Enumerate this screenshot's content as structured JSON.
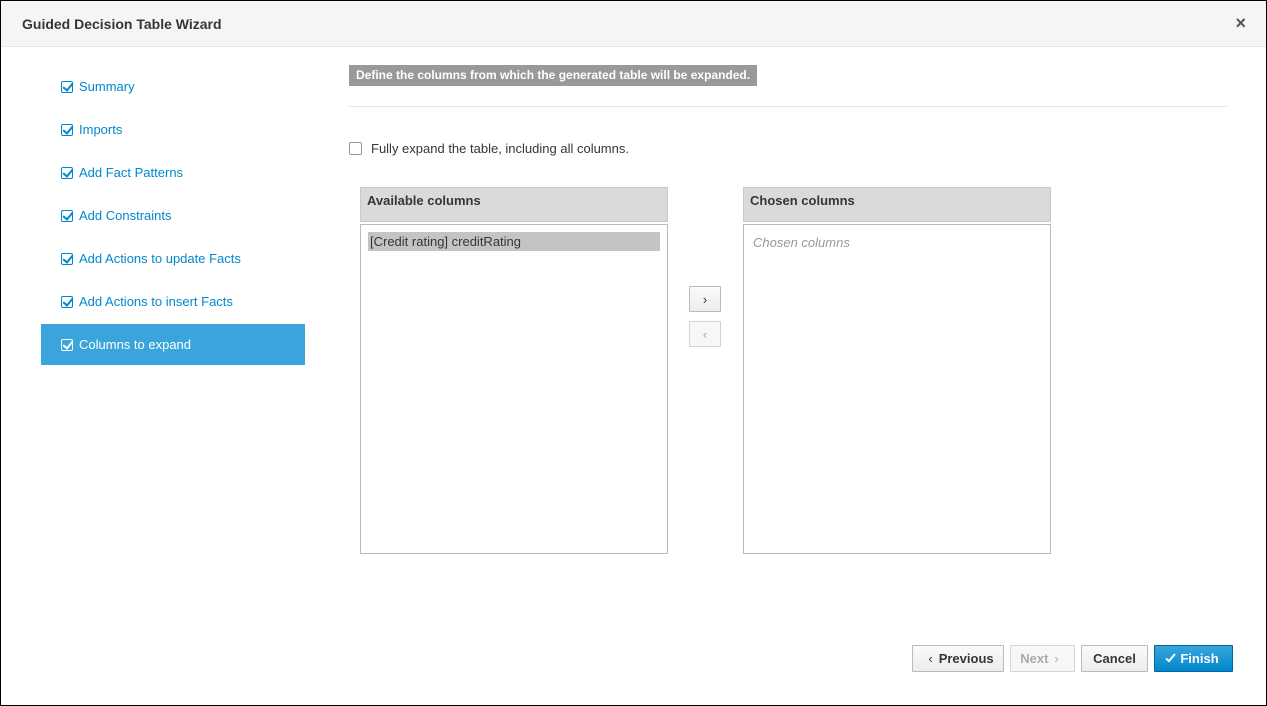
{
  "dialog": {
    "title": "Guided Decision Table Wizard",
    "close_label": "×"
  },
  "steps": [
    {
      "label": "Summary",
      "done": true
    },
    {
      "label": "Imports",
      "done": true
    },
    {
      "label": "Add Fact Patterns",
      "done": true
    },
    {
      "label": "Add Constraints",
      "done": true
    },
    {
      "label": "Add Actions to update Facts",
      "done": true
    },
    {
      "label": "Add Actions to insert Facts",
      "done": true
    },
    {
      "label": "Columns to expand",
      "done": true,
      "active": true
    }
  ],
  "content": {
    "instruction": "Define the columns from which the generated table will be expanded.",
    "expand_label": "Fully expand the table, including all columns.",
    "expand_checked": false
  },
  "available": {
    "header": "Available columns",
    "items": [
      "[Credit rating] creditRating"
    ]
  },
  "chosen": {
    "header": "Chosen columns",
    "placeholder": "Chosen columns",
    "items": []
  },
  "arrows": {
    "add": "›",
    "remove": "‹"
  },
  "footer": {
    "previous": "Previous",
    "next": "Next",
    "cancel": "Cancel",
    "finish": "Finish",
    "prev_chevron": "‹",
    "next_chevron": "›"
  },
  "colors": {
    "accent": "#0088ce",
    "active_step_bg": "#39a5dc"
  }
}
